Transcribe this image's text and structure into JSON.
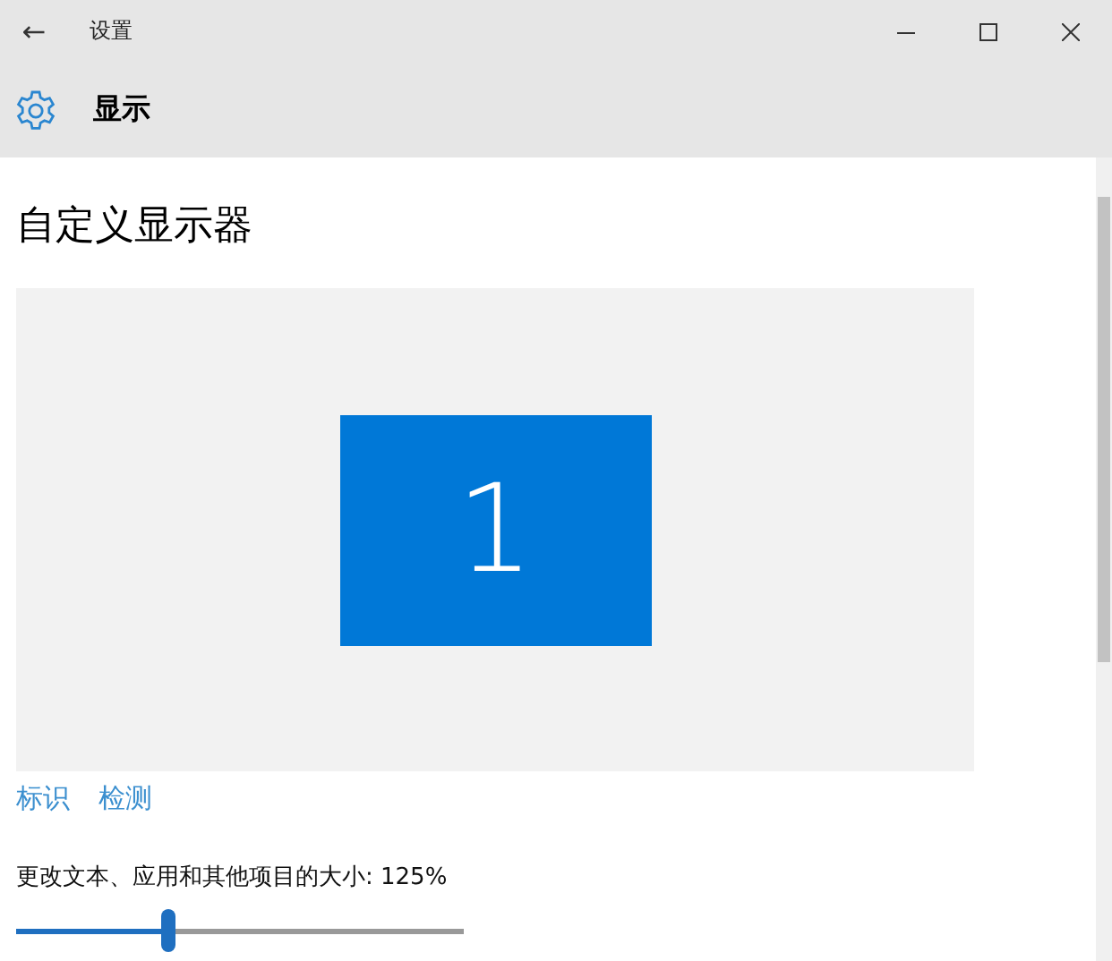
{
  "window": {
    "title": "设置",
    "back": "←"
  },
  "header": {
    "title": "显示"
  },
  "content": {
    "heading": "自定义显示器",
    "monitors": [
      {
        "label": "1",
        "selected": true
      }
    ],
    "links": [
      "标识",
      "检测"
    ],
    "scale": {
      "label": "更改文本、应用和其他项目的大小: 125%",
      "level": 0.34
    }
  }
}
